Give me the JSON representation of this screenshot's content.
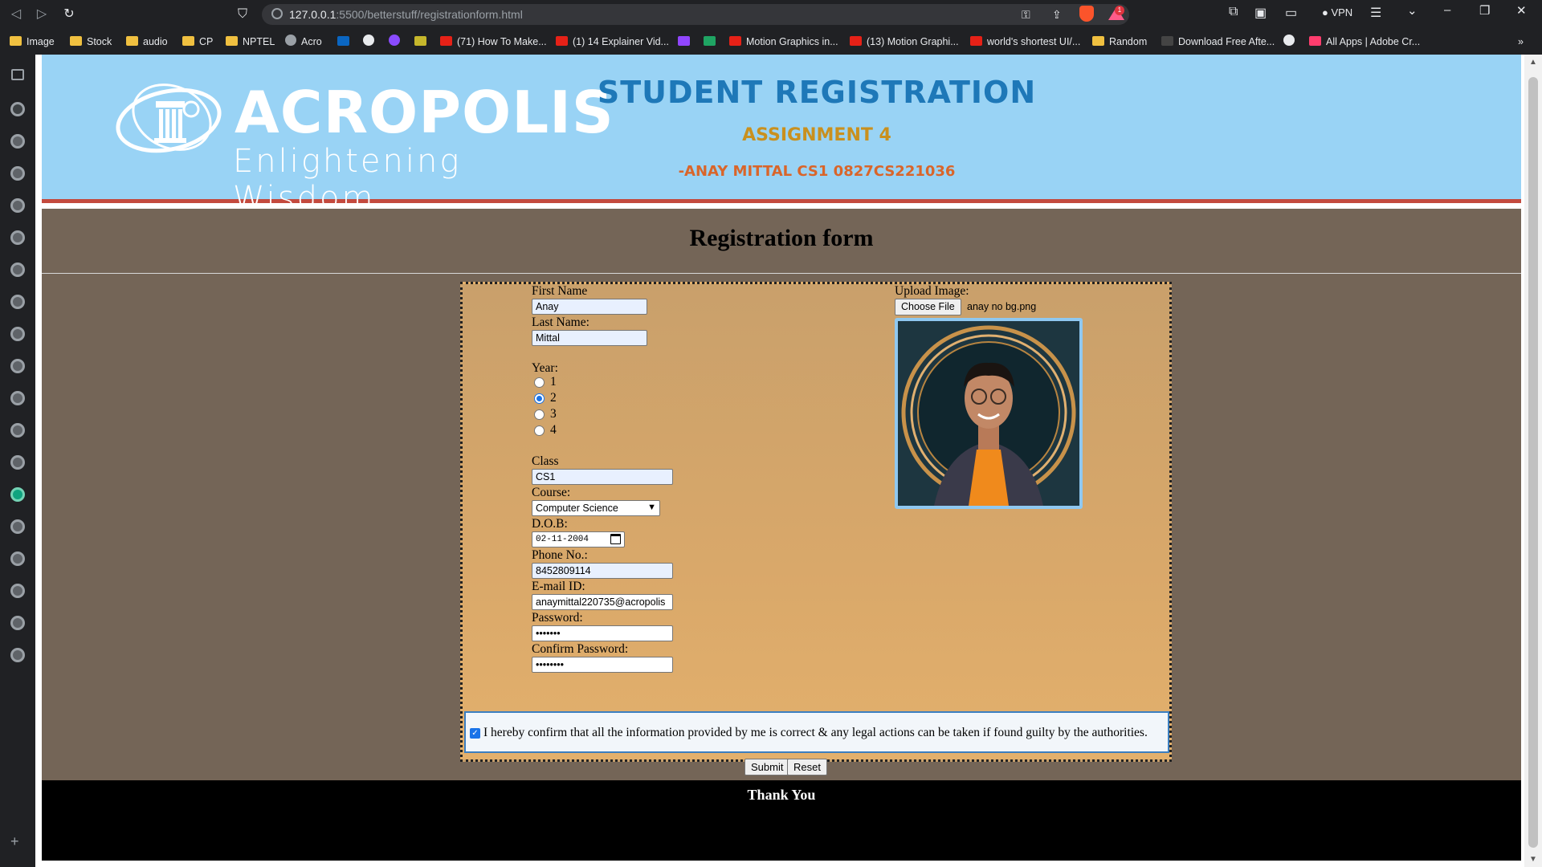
{
  "browser": {
    "url_host": "127.0.0.1",
    "url_path": ":5500/betterstuff/registrationform.html",
    "vpn_label": "VPN",
    "notification_count": "1"
  },
  "bookmarks": [
    {
      "label": "Image",
      "icon": "folder-icon"
    },
    {
      "label": "Stock",
      "icon": "folder-icon"
    },
    {
      "label": "audio",
      "icon": "folder-icon"
    },
    {
      "label": "CP",
      "icon": "folder-icon"
    },
    {
      "label": "NPTEL",
      "icon": "folder-icon"
    },
    {
      "label": "Acro",
      "icon": "globe-icon"
    },
    {
      "label": "(71) How To Make...",
      "icon": "youtube-icon"
    },
    {
      "label": "(1) 14 Explainer Vid...",
      "icon": "youtube-icon"
    },
    {
      "label": "Motion Graphics in...",
      "icon": "youtube-icon"
    },
    {
      "label": "(13) Motion Graphi...",
      "icon": "youtube-icon"
    },
    {
      "label": "world's shortest UI/...",
      "icon": "youtube-icon"
    },
    {
      "label": "Random",
      "icon": "folder-icon"
    },
    {
      "label": "Download Free Afte...",
      "icon": "m-icon"
    },
    {
      "label": "All Apps | Adobe Cr...",
      "icon": "adobe-icon"
    }
  ],
  "header": {
    "logo_name": "ACROPOLIS",
    "logo_tagline": "Enlightening Wisdom",
    "title": "STUDENT REGISTRATION",
    "assignment": "ASSIGNMENT 4",
    "author": "-ANAY MITTAL CS1 0827CS221036"
  },
  "form": {
    "heading": "Registration form",
    "first_name_label": "First Name",
    "first_name_value": "Anay",
    "last_name_label": "Last Name:",
    "last_name_value": "Mittal",
    "year_label": "Year:",
    "year_options": [
      "1",
      "2",
      "3",
      "4"
    ],
    "year_selected": "2",
    "class_label": "Class",
    "class_value": "CS1",
    "course_label": "Course:",
    "course_value": "Computer Science",
    "dob_label": "D.O.B:",
    "dob_value": "02-11-2004",
    "phone_label": "Phone No.:",
    "phone_value": "8452809114",
    "email_label": "E-mail ID:",
    "email_value": "anaymittal220735@acropolis",
    "password_label": "Password:",
    "password_value": "•••••••",
    "confirm_label": "Confirm Password:",
    "confirm_value": "••••••••",
    "upload_label": "Upload Image:",
    "choose_file_label": "Choose File",
    "file_name": "anay no bg.png",
    "confirm_text": "I hereby confirm that all the information provided by me is correct & any legal actions can be taken if found guilty by the authorities.",
    "confirm_checked": true,
    "submit_label": "Submit",
    "reset_label": "Reset"
  },
  "footer": {
    "text": "Thank You"
  },
  "colors": {
    "header_bg": "#99d3f5",
    "title_blue": "#1e78b8",
    "assign_gold": "#c9901e",
    "author_orange": "#d9652a",
    "body_bg": "#746557",
    "form_bg": "#d9a86a"
  }
}
